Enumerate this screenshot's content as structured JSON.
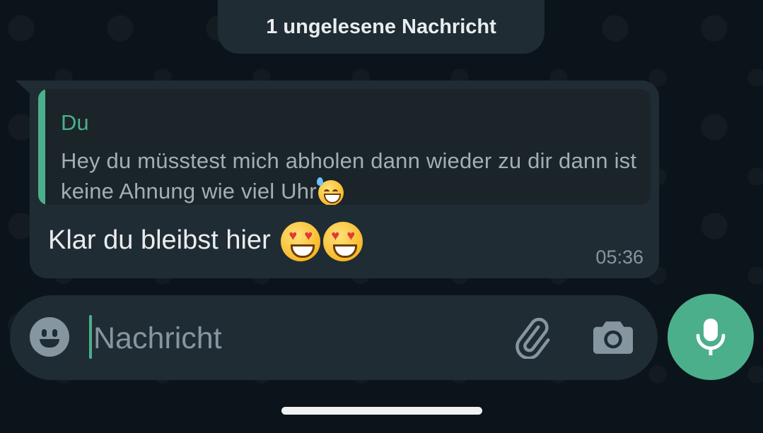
{
  "unread_banner": {
    "text": "1 ungelesene Nachricht"
  },
  "message": {
    "quote": {
      "author": "Du",
      "text": "Hey du müsstest mich abholen dann wieder zu dir dann ist keine Ahnung wie viel Uhr",
      "emoji": "grinning-face-with-sweat"
    },
    "text": "Klar du bleibst hier",
    "emojis": [
      "smiling-face-with-heart-eyes",
      "smiling-face-with-heart-eyes"
    ],
    "time": "05:36"
  },
  "composer": {
    "placeholder": "Nachricht",
    "value": "",
    "icons": [
      "emoji-icon",
      "paperclip-icon",
      "camera-icon",
      "microphone-icon"
    ]
  },
  "colors": {
    "background": "#0b141a",
    "bubble": "#202c33",
    "quote_background": "#1a2429",
    "accent": "#4caf8c",
    "text_primary": "#e9edef",
    "text_secondary": "#8696a0"
  }
}
